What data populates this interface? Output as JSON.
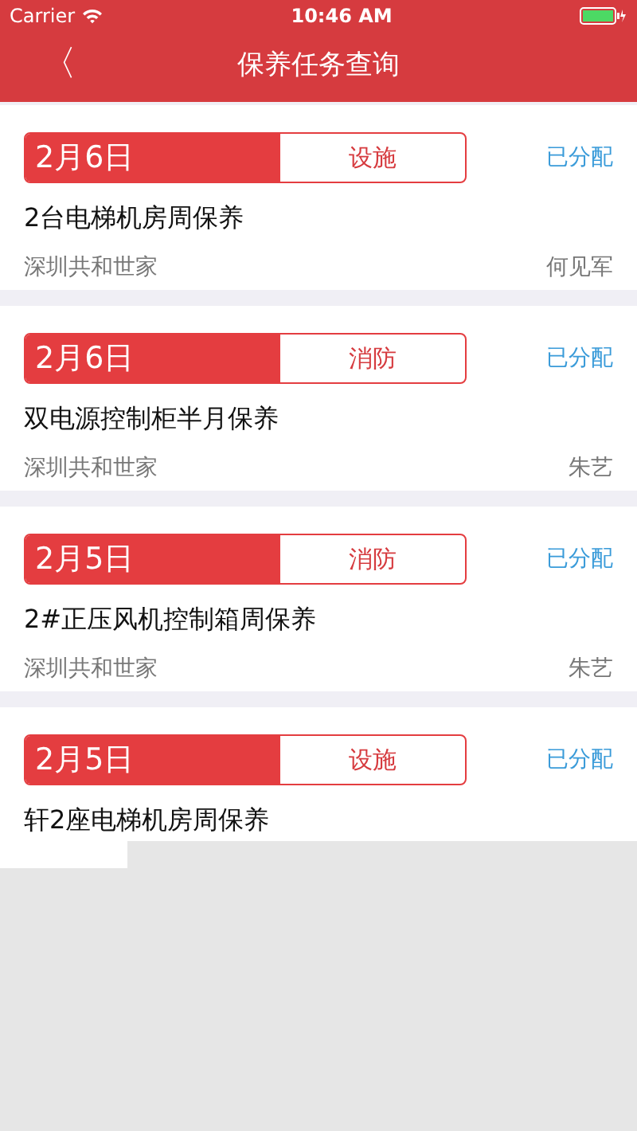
{
  "status_bar": {
    "carrier": "Carrier",
    "time": "10:46 AM"
  },
  "nav": {
    "back": "〈",
    "title": "保养任务查询"
  },
  "tasks": [
    {
      "date": "2月6日",
      "category": "设施",
      "status": "已分配",
      "title": "2台电梯机房周保养",
      "location": "深圳共和世家",
      "assignee": "何见军"
    },
    {
      "date": "2月6日",
      "category": "消防",
      "status": "已分配",
      "title": "双电源控制柜半月保养",
      "location": "深圳共和世家",
      "assignee": "朱艺"
    },
    {
      "date": "2月5日",
      "category": "消防",
      "status": "已分配",
      "title": "2#正压风机控制箱周保养",
      "location": "深圳共和世家",
      "assignee": "朱艺"
    },
    {
      "date": "2月5日",
      "category": "设施",
      "status": "已分配",
      "title": "轩2座电梯机房周保养"
    }
  ]
}
